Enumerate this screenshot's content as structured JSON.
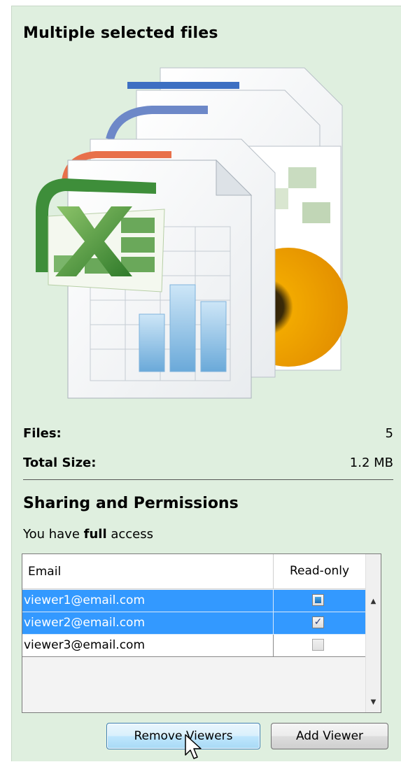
{
  "details": {
    "title": "Multiple selected files",
    "files_label": "Files:",
    "files_value": "5",
    "size_label": "Total Size:",
    "size_value": "1.2 MB"
  },
  "sharing": {
    "title": "Sharing and Permissions",
    "access_prefix": "You have ",
    "access_level": "full",
    "access_suffix": " access",
    "columns": [
      "Email",
      "Read-only"
    ],
    "rows": [
      {
        "email": "viewer1@email.com",
        "read_only": "indeterminate",
        "selected": true
      },
      {
        "email": "viewer2@email.com",
        "read_only": "checked",
        "selected": true
      },
      {
        "email": "viewer3@email.com",
        "read_only": "unchecked",
        "selected": false
      }
    ],
    "remove_button": "Remove Viewers",
    "add_button": "Add Viewer"
  },
  "icons": {
    "illustration": "multiple-files-icon",
    "scroll_up": "chevron-up-icon",
    "scroll_down": "chevron-down-icon",
    "cursor": "mouse-pointer-icon"
  },
  "colors": {
    "panel_bg": "#dfefdf",
    "selection": "#3399ff"
  }
}
